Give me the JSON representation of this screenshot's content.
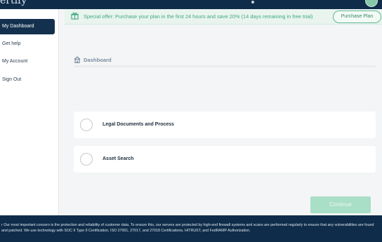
{
  "header": {
    "brand": "ertify"
  },
  "sidebar": {
    "items": [
      {
        "label": "My Dashboard",
        "active": true
      },
      {
        "label": "Get help",
        "active": false
      },
      {
        "label": "My Account",
        "active": false
      },
      {
        "label": "Sign Out",
        "active": false
      }
    ]
  },
  "offer": {
    "text": "Special offer: Purchase your plan in the first 24 hours and save 20%  (14 days remaining in free trial)",
    "button_label": "Purchase Plan",
    "icon": "gift-icon"
  },
  "dashboard": {
    "title": "Dashboard",
    "icon": "home-icon"
  },
  "options": [
    {
      "label": "Legal Documents and Process",
      "selected": false
    },
    {
      "label": "Asset Search",
      "selected": false
    }
  ],
  "continue_label": "Continue",
  "footer": {
    "text": "r Our most important concern is the protection and reliability of customer data. To ensure this, our servers are protected by high-end firewall systems and scans are performed regularly to ensure that any vulnerabilities are found and patched. We use technology with SOC II Type II Certification, ISO 27001, 27017, and 27018 Certifications, HITRUST, and FedRAMP Authorization."
  },
  "colors": {
    "navy": "#0f2d4a",
    "accent_green": "#3fa980",
    "continue_disabled": "#a9dec7"
  }
}
